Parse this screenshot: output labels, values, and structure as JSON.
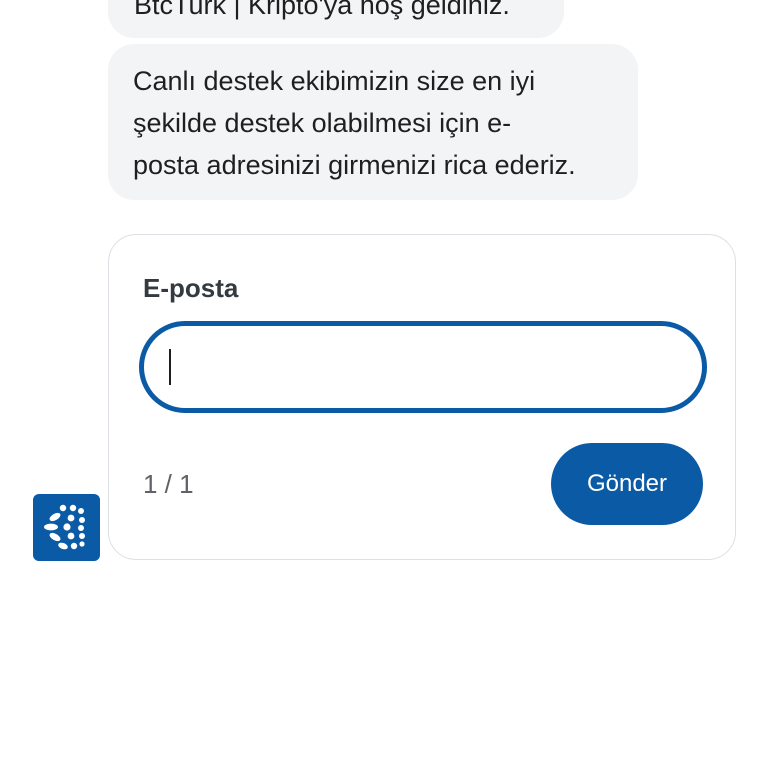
{
  "messages": {
    "greeting": "BtcTurk | Kripto'ya hoş geldiniz.",
    "request_lines": [
      "Canlı destek ekibimizin size en iyi",
      "şekilde destek olabilmesi için e-",
      "posta adresinizi girmenizi rica ederiz."
    ]
  },
  "form": {
    "field_label": "E-posta",
    "email_value": "",
    "email_placeholder": "",
    "step_counter": "1 / 1",
    "submit_label": "Gönder"
  },
  "bot_avatar": {
    "icon": "btcturk-logo-icon"
  },
  "colors": {
    "accent": "#0a5aa6",
    "bubble_bg": "#f3f4f6",
    "card_border": "#dcdfe4",
    "muted_text": "#5f6368"
  }
}
